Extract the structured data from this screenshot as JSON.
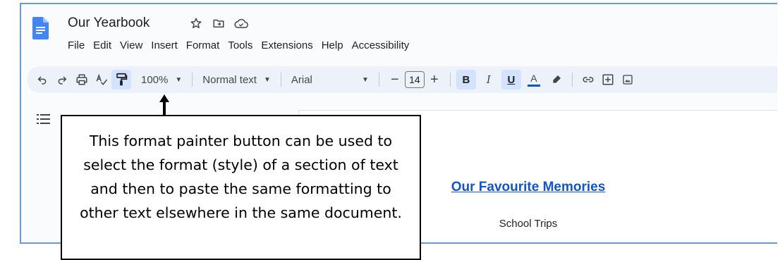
{
  "app": {
    "doc_title": "Our Yearbook",
    "menu": [
      "File",
      "Edit",
      "View",
      "Insert",
      "Format",
      "Tools",
      "Extensions",
      "Help",
      "Accessibility"
    ],
    "title_icons": [
      "star-icon",
      "move-to-folder-icon",
      "cloud-saved-icon"
    ]
  },
  "toolbar": {
    "zoom": "100%",
    "style": "Normal text",
    "font": "Arial",
    "font_size": "14",
    "decrease_size": "−",
    "increase_size": "+",
    "bold": "B",
    "italic": "I",
    "underline": "U",
    "text_color": "A",
    "text_color_value": "#0b57d0",
    "active_button": "paint-format"
  },
  "document": {
    "heading": "Our Favourite Memories",
    "subheading": "School Trips"
  },
  "callout": {
    "text": "This format painter button can be used to select the format (style) of a section of text and then to paste the same formatting to other text elsewhere in the same document."
  },
  "colors": {
    "accent": "#1155cc",
    "toolbar_bg": "#edf2fa",
    "active_bg": "#d3e3fd",
    "frame_border": "#6b9bd1"
  }
}
